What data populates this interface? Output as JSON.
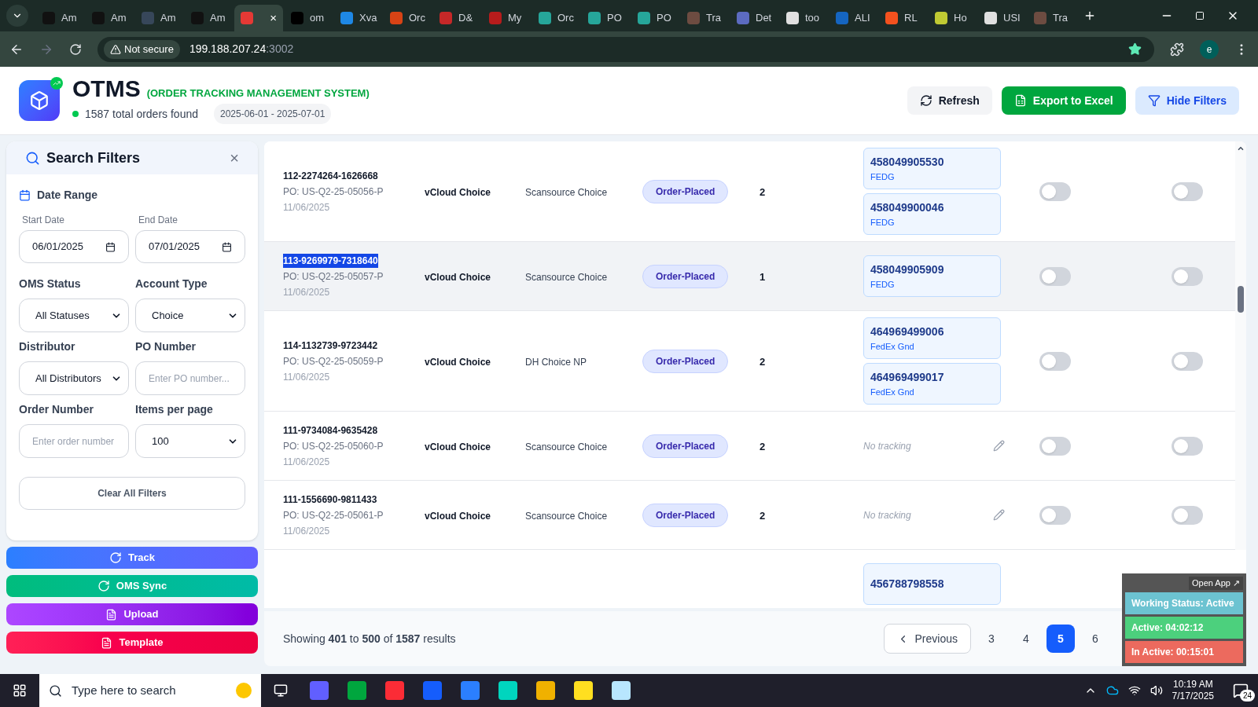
{
  "browser": {
    "tabs": [
      {
        "title": "Am",
        "selected": false,
        "color": "#111111"
      },
      {
        "title": "Am",
        "selected": false,
        "color": "#111111"
      },
      {
        "title": "Am",
        "selected": false,
        "color": "#37475a"
      },
      {
        "title": "Am",
        "selected": false,
        "color": "#111111"
      },
      {
        "close": "×",
        "selected": true,
        "color": "#e53935"
      },
      {
        "title": "om",
        "selected": false,
        "color": "#000000"
      },
      {
        "title": "Xva",
        "selected": false,
        "color": "#1e88e5"
      },
      {
        "title": "Orc",
        "selected": false,
        "color": "#d84315"
      },
      {
        "title": "D&",
        "selected": false,
        "color": "#c62828"
      },
      {
        "title": "My",
        "selected": false,
        "color": "#b71c1c"
      },
      {
        "title": "Orc",
        "selected": false,
        "color": "#26a69a"
      },
      {
        "title": "PO",
        "selected": false,
        "color": "#26a69a"
      },
      {
        "title": "PO",
        "selected": false,
        "color": "#26a69a"
      },
      {
        "title": "Tra",
        "selected": false,
        "color": "#6d4c41"
      },
      {
        "title": "Det",
        "selected": false,
        "color": "#5c6bc0"
      },
      {
        "title": "too",
        "selected": false,
        "color": "#e0e0e0"
      },
      {
        "title": "ALI",
        "selected": false,
        "color": "#1565c0"
      },
      {
        "title": "RL",
        "selected": false,
        "color": "#f4511e"
      },
      {
        "title": "Ho",
        "selected": false,
        "color": "#c0ca33"
      },
      {
        "title": "USI",
        "selected": false,
        "color": "#e0e0e0"
      },
      {
        "title": "Tra",
        "selected": false,
        "color": "#6d4c41"
      }
    ],
    "security": "Not secure",
    "url": "199.188.207.24",
    "port": ":3002",
    "avatar": "e"
  },
  "header": {
    "title": "OTMS",
    "subtitle": "(ORDER TRACKING MANAGEMENT SYSTEM)",
    "count_text": "1587 total orders found",
    "date_range": "2025-06-01 - 2025-07-01",
    "buttons": [
      {
        "label": "Refresh",
        "kind": "refresh"
      },
      {
        "label": "Export to Excel",
        "kind": "export"
      },
      {
        "label": "Hide Filters",
        "kind": "filter"
      }
    ]
  },
  "filters": {
    "title": "Search Filters",
    "close": "×",
    "date_range_label": "Date Range",
    "start_label": "Start Date",
    "start_value": "06/01/2025",
    "end_label": "End Date",
    "end_value": "07/01/2025",
    "fields": [
      {
        "label": "OMS Status",
        "kind": "select",
        "value": "All Statuses"
      },
      {
        "label": "Account Type",
        "kind": "select",
        "value": "Choice"
      },
      {
        "label": "Distributor",
        "kind": "select",
        "value": "All Distributors"
      },
      {
        "label": "PO Number",
        "kind": "input",
        "placeholder": "Enter PO number..."
      },
      {
        "label": "Order Number",
        "kind": "input",
        "placeholder": "Enter order number"
      },
      {
        "label": "Items per page",
        "kind": "select",
        "value": "100"
      }
    ],
    "clear": "Clear All Filters"
  },
  "actions": [
    {
      "label": "Track",
      "kind": "track"
    },
    {
      "label": "OMS Sync",
      "kind": "sync"
    },
    {
      "label": "Upload",
      "kind": "upload"
    },
    {
      "label": "Template",
      "kind": "template"
    }
  ],
  "table": {
    "rows": [
      {
        "order": "112-2274264-1626668",
        "order_selected": false,
        "po": "PO: US-Q2-25-05056-P",
        "date": "11/06/2025",
        "account": "vCloud Choice",
        "distributor": "Scansource Choice",
        "status": "Order-Placed",
        "qty": "2",
        "tracking": [
          {
            "number": "458049905530",
            "carrier": "FEDG"
          },
          {
            "number": "458049900046",
            "carrier": "FEDG"
          }
        ],
        "toggle_1": false,
        "toggle_2": false,
        "selected": false
      },
      {
        "order": "113-9269979-7318640",
        "order_selected": true,
        "po": "PO: US-Q2-25-05057-P",
        "date": "11/06/2025",
        "account": "vCloud Choice",
        "distributor": "Scansource Choice",
        "status": "Order-Placed",
        "qty": "1",
        "tracking": [
          {
            "number": "458049905909",
            "carrier": "FEDG"
          }
        ],
        "toggle_1": false,
        "toggle_2": false,
        "selected": true
      },
      {
        "order": "114-1132739-9723442",
        "order_selected": false,
        "po": "PO: US-Q2-25-05059-P",
        "date": "11/06/2025",
        "account": "vCloud Choice",
        "distributor": "DH Choice NP",
        "status": "Order-Placed",
        "qty": "2",
        "tracking": [
          {
            "number": "464969499006",
            "carrier": "FedEx Gnd"
          },
          {
            "number": "464969499017",
            "carrier": "FedEx Gnd"
          }
        ],
        "toggle_1": false,
        "toggle_2": false,
        "selected": false
      },
      {
        "order": "111-9734084-9635428",
        "order_selected": false,
        "po": "PO: US-Q2-25-05060-P",
        "date": "11/06/2025",
        "account": "vCloud Choice",
        "distributor": "Scansource Choice",
        "status": "Order-Placed",
        "qty": "2",
        "no_tracking": "No tracking",
        "toggle_1": false,
        "toggle_2": false,
        "selected": false
      },
      {
        "order": "111-1556690-9811433",
        "order_selected": false,
        "po": "PO: US-Q2-25-05061-P",
        "date": "11/06/2025",
        "account": "vCloud Choice",
        "distributor": "Scansource Choice",
        "status": "Order-Placed",
        "qty": "2",
        "no_tracking": "No tracking",
        "toggle_1": false,
        "toggle_2": false,
        "selected": false
      },
      {
        "tracking": [
          {
            "number": "456788798558"
          }
        ],
        "selected": false
      }
    ]
  },
  "pagination": {
    "showing": "Showing **401** to **500** of **1587** results",
    "previous": "Previous",
    "pages": [
      {
        "label": "3",
        "selected": false
      },
      {
        "label": "4",
        "selected": false
      },
      {
        "label": "5",
        "selected": true
      },
      {
        "label": "6",
        "selected": false
      }
    ]
  },
  "widget": {
    "open": "Open App ↗",
    "working": "Working Status: Active",
    "active": "Active: 04:02:12",
    "inactive": "In Active: 00:15:01"
  },
  "taskbar": {
    "search_placeholder": "Type here to search",
    "time": "10:19 AM",
    "date": "7/17/2025",
    "notifications": "24"
  }
}
